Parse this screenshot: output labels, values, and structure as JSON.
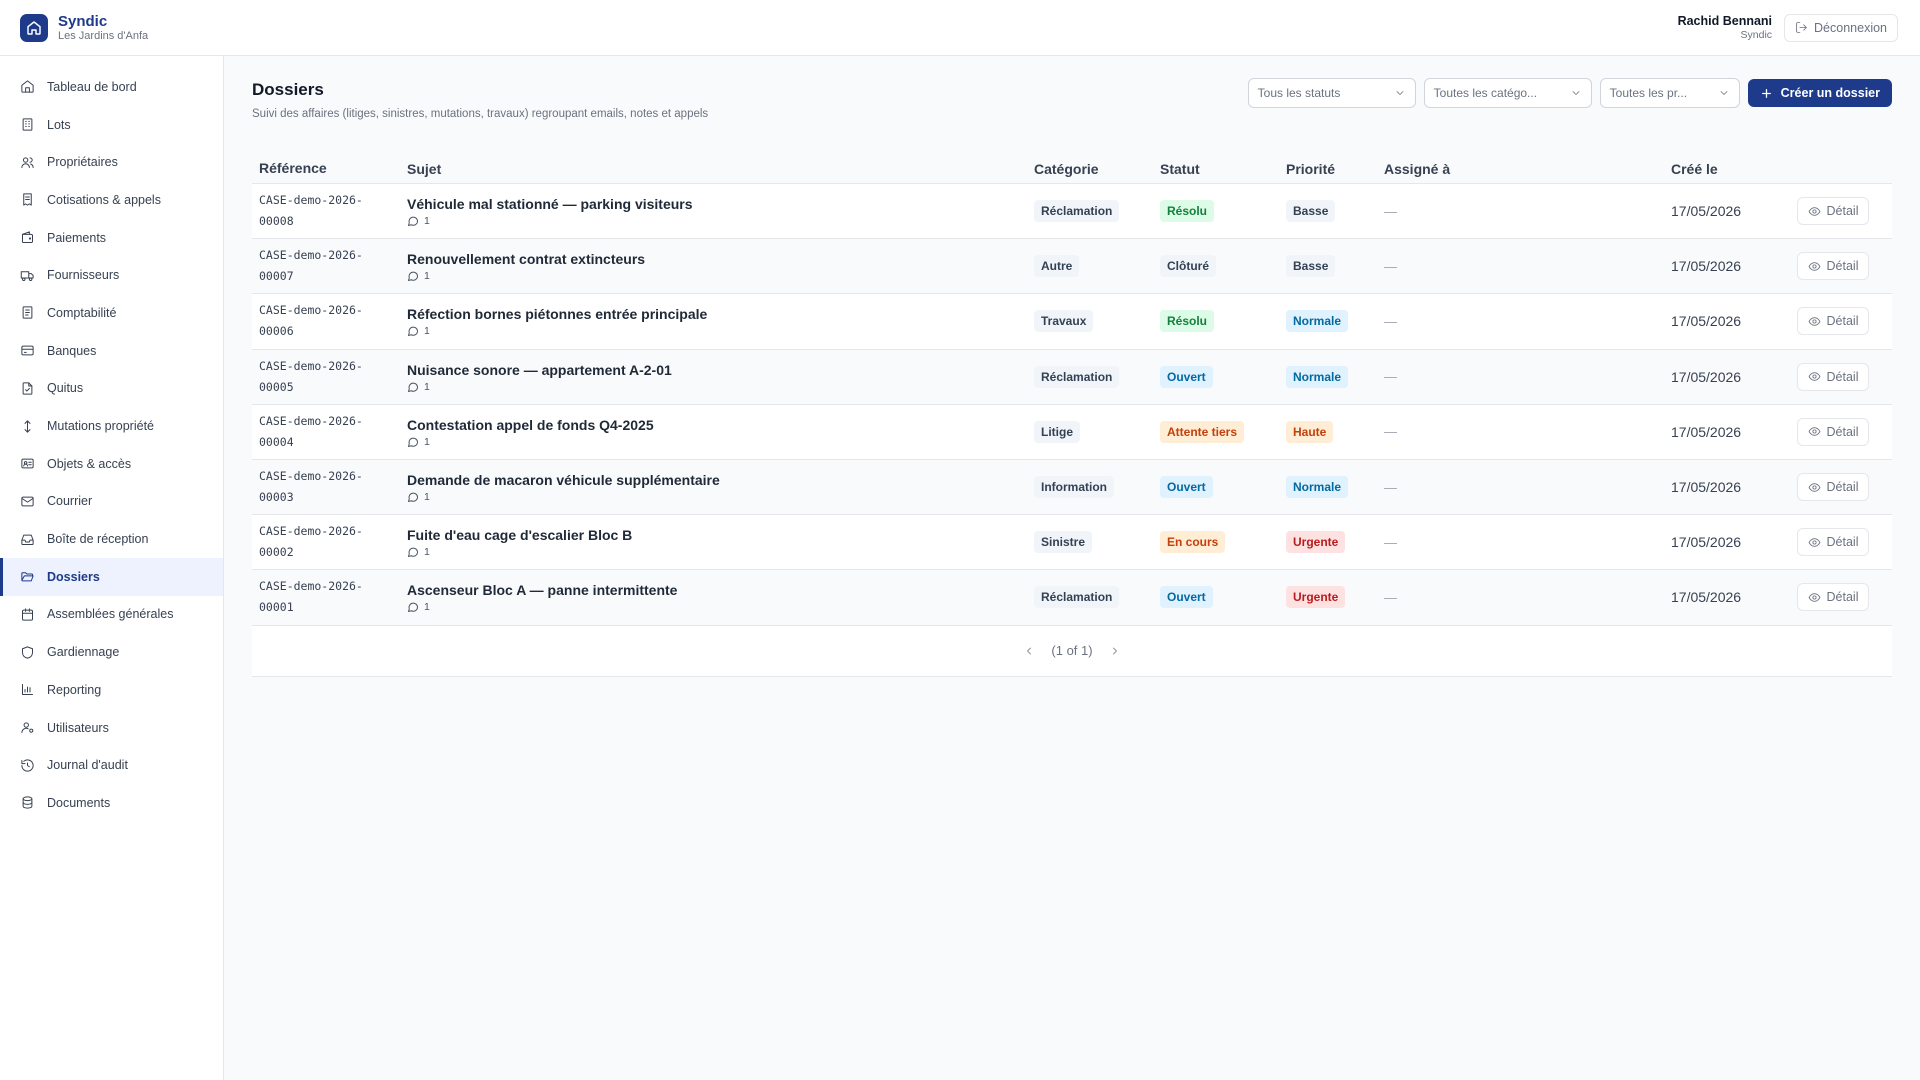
{
  "brand": {
    "name": "Syndic",
    "subtitle": "Les Jardins d'Anfa"
  },
  "user": {
    "name": "Rachid Bennani",
    "role": "Syndic",
    "logout_label": "Déconnexion"
  },
  "sidebar": {
    "active": "Dossiers",
    "items": [
      {
        "label": "Tableau de bord",
        "icon": "home-icon"
      },
      {
        "label": "Lots",
        "icon": "building-icon"
      },
      {
        "label": "Propriétaires",
        "icon": "users-icon"
      },
      {
        "label": "Cotisations & appels",
        "icon": "receipt-icon"
      },
      {
        "label": "Paiements",
        "icon": "wallet-icon"
      },
      {
        "label": "Fournisseurs",
        "icon": "truck-icon"
      },
      {
        "label": "Comptabilité",
        "icon": "ledger-icon"
      },
      {
        "label": "Banques",
        "icon": "credit-card-icon"
      },
      {
        "label": "Quitus",
        "icon": "file-check-icon"
      },
      {
        "label": "Mutations propriété",
        "icon": "arrows-up-down-icon"
      },
      {
        "label": "Objets & accès",
        "icon": "id-card-icon"
      },
      {
        "label": "Courrier",
        "icon": "mail-icon"
      },
      {
        "label": "Boîte de réception",
        "icon": "inbox-icon"
      },
      {
        "label": "Dossiers",
        "icon": "folder-open-icon"
      },
      {
        "label": "Assemblées générales",
        "icon": "calendar-icon"
      },
      {
        "label": "Gardiennage",
        "icon": "shield-icon"
      },
      {
        "label": "Reporting",
        "icon": "bar-chart-icon"
      },
      {
        "label": "Utilisateurs",
        "icon": "user-cog-icon"
      },
      {
        "label": "Journal d'audit",
        "icon": "history-icon"
      },
      {
        "label": "Documents",
        "icon": "database-icon"
      }
    ]
  },
  "page": {
    "title": "Dossiers",
    "description": "Suivi des affaires (litiges, sinistres, mutations, travaux) regroupant emails, notes et appels"
  },
  "filters": {
    "status": "Tous les statuts",
    "category": "Toutes les catégo...",
    "priority": "Toutes les pr...",
    "create_label": "Créer un dossier"
  },
  "table": {
    "headers": [
      "Référence",
      "Sujet",
      "Catégorie",
      "Statut",
      "Priorité",
      "Assigné à",
      "Créé le"
    ],
    "detail_label": "Détail",
    "rows": [
      {
        "ref1": "CASE-demo-2026-",
        "ref2": "00008",
        "subject": "Véhicule mal stationné — parking visiteurs",
        "comments": "1",
        "category": "Réclamation",
        "status": "Résolu",
        "status_color": "green",
        "priority": "Basse",
        "priority_color": "gray",
        "assigned": "—",
        "created": "17/05/2026"
      },
      {
        "ref1": "CASE-demo-2026-",
        "ref2": "00007",
        "subject": "Renouvellement contrat extincteurs",
        "comments": "1",
        "category": "Autre",
        "status": "Clôturé",
        "status_color": "gray",
        "priority": "Basse",
        "priority_color": "gray",
        "assigned": "—",
        "created": "17/05/2026"
      },
      {
        "ref1": "CASE-demo-2026-",
        "ref2": "00006",
        "subject": "Réfection bornes piétonnes entrée principale",
        "comments": "1",
        "category": "Travaux",
        "status": "Résolu",
        "status_color": "green",
        "priority": "Normale",
        "priority_color": "blue",
        "assigned": "—",
        "created": "17/05/2026"
      },
      {
        "ref1": "CASE-demo-2026-",
        "ref2": "00005",
        "subject": "Nuisance sonore — appartement A-2-01",
        "comments": "1",
        "category": "Réclamation",
        "status": "Ouvert",
        "status_color": "blue",
        "priority": "Normale",
        "priority_color": "blue",
        "assigned": "—",
        "created": "17/05/2026"
      },
      {
        "ref1": "CASE-demo-2026-",
        "ref2": "00004",
        "subject": "Contestation appel de fonds Q4-2025",
        "comments": "1",
        "category": "Litige",
        "status": "Attente tiers",
        "status_color": "orange",
        "priority": "Haute",
        "priority_color": "orange",
        "assigned": "—",
        "created": "17/05/2026"
      },
      {
        "ref1": "CASE-demo-2026-",
        "ref2": "00003",
        "subject": "Demande de macaron véhicule supplémentaire",
        "comments": "1",
        "category": "Information",
        "status": "Ouvert",
        "status_color": "blue",
        "priority": "Normale",
        "priority_color": "blue",
        "assigned": "—",
        "created": "17/05/2026"
      },
      {
        "ref1": "CASE-demo-2026-",
        "ref2": "00002",
        "subject": "Fuite d'eau cage d'escalier Bloc B",
        "comments": "1",
        "category": "Sinistre",
        "status": "En cours",
        "status_color": "orange",
        "priority": "Urgente",
        "priority_color": "red",
        "assigned": "—",
        "created": "17/05/2026"
      },
      {
        "ref1": "CASE-demo-2026-",
        "ref2": "00001",
        "subject": "Ascenseur Bloc A — panne intermittente",
        "comments": "1",
        "category": "Réclamation",
        "status": "Ouvert",
        "status_color": "blue",
        "priority": "Urgente",
        "priority_color": "red",
        "assigned": "—",
        "created": "17/05/2026"
      }
    ]
  },
  "pagination": {
    "label": "(1 of 1)"
  }
}
